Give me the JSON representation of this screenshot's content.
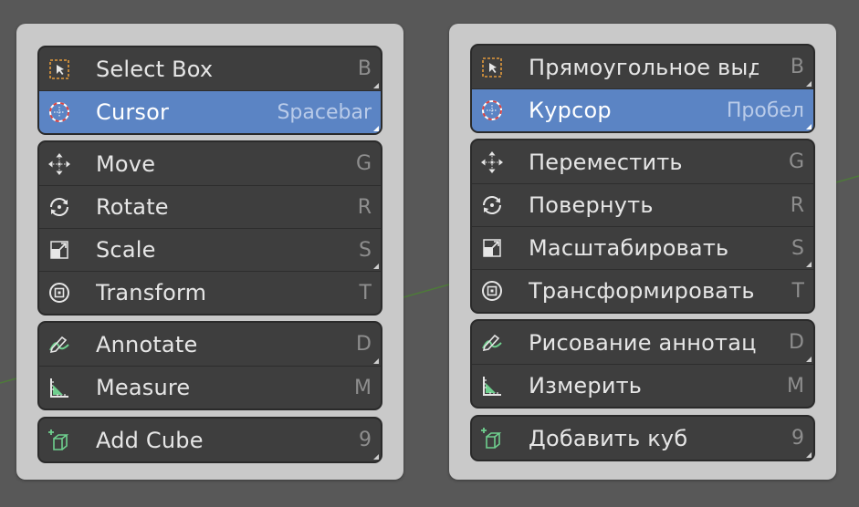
{
  "panels": [
    {
      "groups": [
        {
          "items": [
            {
              "label": "Select Box",
              "shortcut": "B",
              "icon": "select-box-icon",
              "active": false,
              "corner": true
            },
            {
              "label": "Cursor",
              "shortcut": "Spacebar",
              "icon": "cursor-icon",
              "active": true,
              "corner": true
            }
          ]
        },
        {
          "items": [
            {
              "label": "Move",
              "shortcut": "G",
              "icon": "move-icon",
              "active": false,
              "corner": false
            },
            {
              "label": "Rotate",
              "shortcut": "R",
              "icon": "rotate-icon",
              "active": false,
              "corner": false
            },
            {
              "label": "Scale",
              "shortcut": "S",
              "icon": "scale-icon",
              "active": false,
              "corner": true
            },
            {
              "label": "Transform",
              "shortcut": "T",
              "icon": "transform-icon",
              "active": false,
              "corner": false
            }
          ]
        },
        {
          "items": [
            {
              "label": "Annotate",
              "shortcut": "D",
              "icon": "annotate-icon",
              "active": false,
              "corner": true
            },
            {
              "label": "Measure",
              "shortcut": "M",
              "icon": "measure-icon",
              "active": false,
              "corner": false
            }
          ]
        },
        {
          "items": [
            {
              "label": "Add Cube",
              "shortcut": "9",
              "icon": "add-cube-icon",
              "active": false,
              "corner": true
            }
          ]
        }
      ]
    },
    {
      "groups": [
        {
          "items": [
            {
              "label": "Прямоугольное выд…",
              "shortcut": "B",
              "icon": "select-box-icon",
              "active": false,
              "corner": true
            },
            {
              "label": "Курсор",
              "shortcut": "Пробел",
              "icon": "cursor-icon",
              "active": true,
              "corner": true
            }
          ]
        },
        {
          "items": [
            {
              "label": "Переместить",
              "shortcut": "G",
              "icon": "move-icon",
              "active": false,
              "corner": false
            },
            {
              "label": "Повернуть",
              "shortcut": "R",
              "icon": "rotate-icon",
              "active": false,
              "corner": false
            },
            {
              "label": "Масштабировать",
              "shortcut": "S",
              "icon": "scale-icon",
              "active": false,
              "corner": true
            },
            {
              "label": "Трансформировать",
              "shortcut": "T",
              "icon": "transform-icon",
              "active": false,
              "corner": false
            }
          ]
        },
        {
          "items": [
            {
              "label": "Рисование аннотац…",
              "shortcut": "D",
              "icon": "annotate-icon",
              "active": false,
              "corner": true
            },
            {
              "label": "Измерить",
              "shortcut": "M",
              "icon": "measure-icon",
              "active": false,
              "corner": false
            }
          ]
        },
        {
          "items": [
            {
              "label": "Добавить куб",
              "shortcut": "9",
              "icon": "add-cube-icon",
              "active": false,
              "corner": true
            }
          ]
        }
      ]
    }
  ]
}
